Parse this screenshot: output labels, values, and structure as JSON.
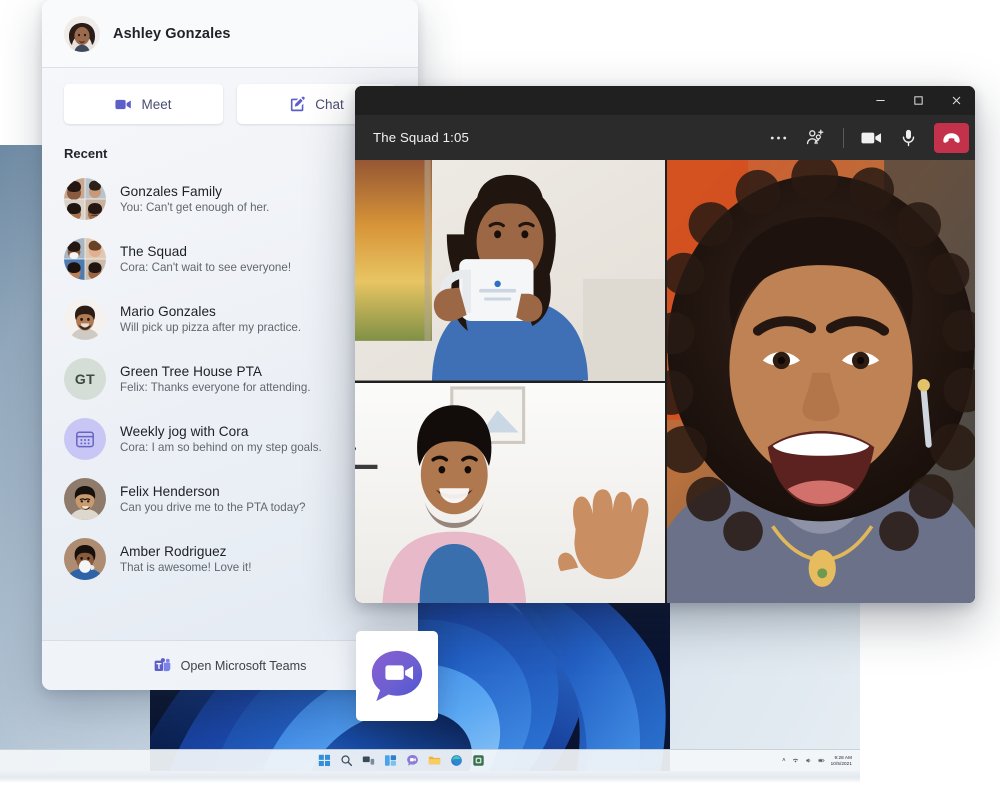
{
  "flyout": {
    "user": {
      "name": "Ashley Gonzales",
      "avatar_icon": "user-avatar-ashley"
    },
    "actions": [
      {
        "label": "Meet",
        "icon": "video-camera-icon"
      },
      {
        "label": "Chat",
        "icon": "compose-chat-icon"
      }
    ],
    "section_label": "Recent",
    "chats": [
      {
        "title": "Gonzales Family",
        "preview": "You: Can't get enough of her.",
        "avatar_type": "group-photo"
      },
      {
        "title": "The Squad",
        "preview": "Cora: Can't wait to see everyone!",
        "avatar_type": "group-photo"
      },
      {
        "title": "Mario Gonzales",
        "preview": "Will pick up pizza after my practice.",
        "avatar_type": "person-photo"
      },
      {
        "title": "Green Tree House PTA",
        "preview": "Felix: Thanks everyone for attending.",
        "avatar_type": "initials",
        "initials": "GT",
        "avatar_bg": "#d4ddd6"
      },
      {
        "title": "Weekly jog with Cora",
        "preview": "Cora: I am so behind on my step goals.",
        "avatar_type": "calendar-icon",
        "avatar_bg": "#c8c6f5"
      },
      {
        "title": "Felix Henderson",
        "preview": "Can you drive me to the PTA today?",
        "avatar_type": "person-photo"
      },
      {
        "title": "Amber Rodriguez",
        "preview": "That is awesome! Love it!",
        "avatar_type": "person-photo"
      }
    ],
    "footer": {
      "label": "Open Microsoft Teams",
      "icon": "microsoft-teams-logo"
    }
  },
  "call_window": {
    "title": "The Squad 1:05",
    "window_controls": {
      "minimize": "–",
      "maximize": "□",
      "close": "✕"
    },
    "controls": [
      {
        "name": "more-options",
        "icon": "ellipsis-icon"
      },
      {
        "name": "add-people",
        "icon": "add-people-icon"
      },
      {
        "name": "toggle-camera",
        "icon": "camera-icon"
      },
      {
        "name": "toggle-mic",
        "icon": "microphone-icon"
      },
      {
        "name": "hang-up",
        "icon": "hangup-icon",
        "color": "#c4314b"
      }
    ],
    "participants": [
      {
        "position": "top-left",
        "description": "woman drinking from mug"
      },
      {
        "position": "bottom-left",
        "description": "man waving"
      },
      {
        "position": "right",
        "description": "woman laughing"
      }
    ]
  },
  "desktop": {
    "wallpaper": "windows-11-bloom",
    "taskbar": {
      "items": [
        {
          "name": "start-button",
          "icon": "windows-logo-icon"
        },
        {
          "name": "search",
          "icon": "search-icon"
        },
        {
          "name": "task-view",
          "icon": "task-view-icon"
        },
        {
          "name": "widgets",
          "icon": "widgets-icon"
        },
        {
          "name": "teams-chat",
          "icon": "teams-chat-icon"
        },
        {
          "name": "file-explorer",
          "icon": "folder-icon"
        },
        {
          "name": "microsoft-edge",
          "icon": "edge-icon"
        },
        {
          "name": "microsoft-store",
          "icon": "store-icon"
        }
      ],
      "tray": {
        "chevron": "˄",
        "icons": [
          "wifi-icon",
          "speaker-icon",
          "battery-icon"
        ],
        "time": "9:28 AM",
        "date": "10/5/2021"
      }
    },
    "app_icon_tile": {
      "name": "teams-chat-flyout-icon",
      "icon": "teams-chat-bubble-icon"
    }
  },
  "colors": {
    "teams_purple": "#5b5fc7",
    "hangup_red": "#c4314b",
    "titlebar_dark": "#202020",
    "callbar_dark": "#2b2b2b"
  }
}
